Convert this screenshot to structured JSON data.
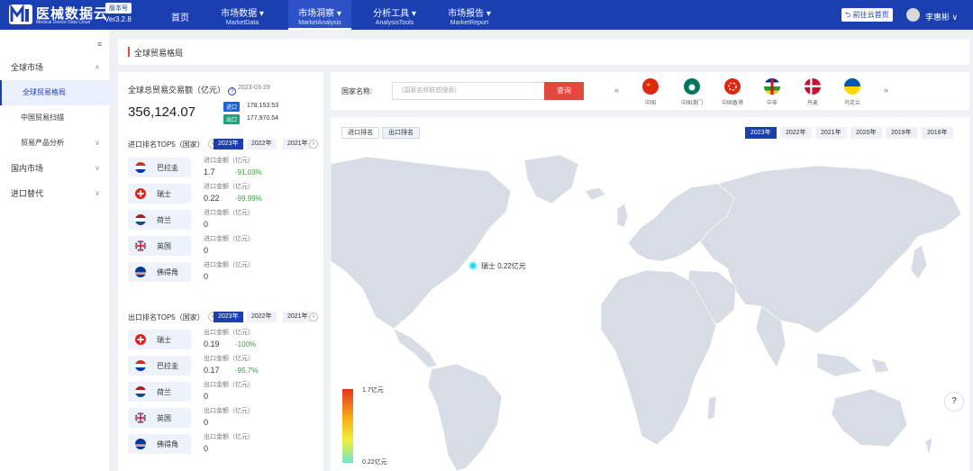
{
  "brand": {
    "name": "医械数据云",
    "subtitle": "Medical Device Data Cloud",
    "version_badge": "版本号",
    "version": "Ver3.2.8"
  },
  "nav": [
    {
      "label": "首页",
      "sub": ""
    },
    {
      "label": "市场数据 ▾",
      "sub": "MarketData"
    },
    {
      "label": "市场洞察 ▾",
      "sub": "MarketAnalysis"
    },
    {
      "label": "分析工具 ▾",
      "sub": "AnalysisTools"
    },
    {
      "label": "市场报告 ▾",
      "sub": "MarketReport"
    }
  ],
  "header": {
    "cloud_btn": "⮌ 前往云首页",
    "user": "李惠彬 ∨"
  },
  "sidebar": {
    "collapse": "≡",
    "items": [
      {
        "label": "全球市场",
        "chev": "∧"
      },
      {
        "label": "全球贸易格局",
        "chev": ""
      },
      {
        "label": "中国贸易扫描",
        "chev": ""
      },
      {
        "label": "贸易产品分析",
        "chev": "∨"
      },
      {
        "label": "国内市场",
        "chev": "∨"
      },
      {
        "label": "进口替代",
        "chev": "∨"
      }
    ]
  },
  "page_title": "全球贸易格局",
  "summary": {
    "title": "全球总贸易交易额（亿元）",
    "help": "?",
    "date": "2023-03-29",
    "total": "356,124.07",
    "import_tag": "进口",
    "import_val": "178,153.53",
    "export_tag": "出口",
    "export_val": "177,970.54"
  },
  "import_top5": {
    "title": "进口排名TOP5（国家）",
    "years": [
      "2023年",
      "2022年",
      "2021年"
    ],
    "rows": [
      {
        "country": "巴拉圭",
        "label": "进口金额（亿元）",
        "amount": "1.7",
        "change": "-91.03%"
      },
      {
        "country": "瑞士",
        "label": "进口金额（亿元）",
        "amount": "0.22",
        "change": "-99.99%"
      },
      {
        "country": "荷兰",
        "label": "进口金额（亿元）",
        "amount": "0",
        "change": ""
      },
      {
        "country": "英国",
        "label": "进口金额（亿元）",
        "amount": "0",
        "change": ""
      },
      {
        "country": "佛得角",
        "label": "进口金额（亿元）",
        "amount": "0",
        "change": ""
      }
    ]
  },
  "export_top5": {
    "title": "出口排名TOP5（国家）",
    "years": [
      "2023年",
      "2022年",
      "2021年"
    ],
    "rows": [
      {
        "country": "瑞士",
        "label": "出口金额（亿元）",
        "amount": "0.19",
        "change": "-100%"
      },
      {
        "country": "巴拉圭",
        "label": "出口金额（亿元）",
        "amount": "0.17",
        "change": "-95.7%"
      },
      {
        "country": "荷兰",
        "label": "出口金额（亿元）",
        "amount": "0",
        "change": ""
      },
      {
        "country": "英国",
        "label": "出口金额（亿元）",
        "amount": "0",
        "change": ""
      },
      {
        "country": "佛得角",
        "label": "出口金额（亿元）",
        "amount": "0",
        "change": ""
      }
    ]
  },
  "search": {
    "label": "国家名称:",
    "placeholder": "(国家名称联想搜索)",
    "button": "查询"
  },
  "flag_strip": [
    "中国",
    "中国澳门",
    "中国香港",
    "中非",
    "丹麦",
    "乌克兰"
  ],
  "map": {
    "tabs": [
      "进口排名",
      "出口排名"
    ],
    "years": [
      "2023年",
      "2022年",
      "2021年",
      "2020年",
      "2019年",
      "2018年"
    ],
    "marker_label": "瑞士 0.22亿元",
    "legend_max": "1.7亿元",
    "legend_min": "0.22亿元"
  },
  "help_icon": "?"
}
